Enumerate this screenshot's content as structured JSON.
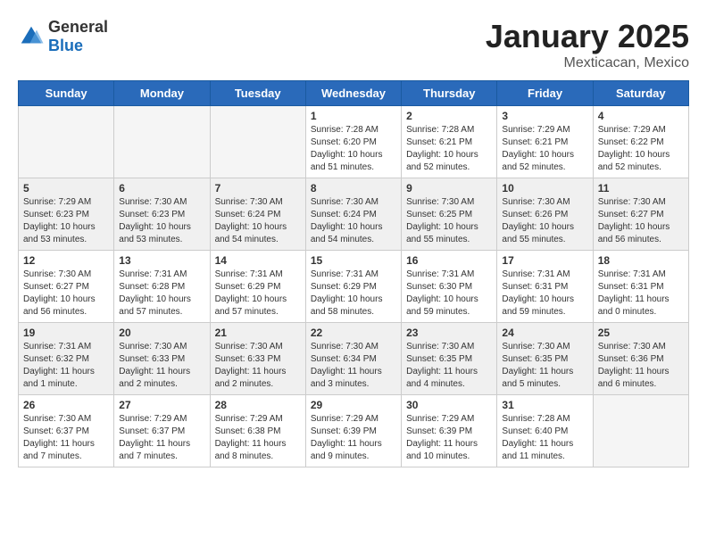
{
  "logo": {
    "text_general": "General",
    "text_blue": "Blue"
  },
  "header": {
    "month_year": "January 2025",
    "location": "Mexticacan, Mexico"
  },
  "weekdays": [
    "Sunday",
    "Monday",
    "Tuesday",
    "Wednesday",
    "Thursday",
    "Friday",
    "Saturday"
  ],
  "weeks": [
    {
      "shaded": false,
      "days": [
        {
          "num": "",
          "info": ""
        },
        {
          "num": "",
          "info": ""
        },
        {
          "num": "",
          "info": ""
        },
        {
          "num": "1",
          "info": "Sunrise: 7:28 AM\nSunset: 6:20 PM\nDaylight: 10 hours\nand 51 minutes."
        },
        {
          "num": "2",
          "info": "Sunrise: 7:28 AM\nSunset: 6:21 PM\nDaylight: 10 hours\nand 52 minutes."
        },
        {
          "num": "3",
          "info": "Sunrise: 7:29 AM\nSunset: 6:21 PM\nDaylight: 10 hours\nand 52 minutes."
        },
        {
          "num": "4",
          "info": "Sunrise: 7:29 AM\nSunset: 6:22 PM\nDaylight: 10 hours\nand 52 minutes."
        }
      ]
    },
    {
      "shaded": true,
      "days": [
        {
          "num": "5",
          "info": "Sunrise: 7:29 AM\nSunset: 6:23 PM\nDaylight: 10 hours\nand 53 minutes."
        },
        {
          "num": "6",
          "info": "Sunrise: 7:30 AM\nSunset: 6:23 PM\nDaylight: 10 hours\nand 53 minutes."
        },
        {
          "num": "7",
          "info": "Sunrise: 7:30 AM\nSunset: 6:24 PM\nDaylight: 10 hours\nand 54 minutes."
        },
        {
          "num": "8",
          "info": "Sunrise: 7:30 AM\nSunset: 6:24 PM\nDaylight: 10 hours\nand 54 minutes."
        },
        {
          "num": "9",
          "info": "Sunrise: 7:30 AM\nSunset: 6:25 PM\nDaylight: 10 hours\nand 55 minutes."
        },
        {
          "num": "10",
          "info": "Sunrise: 7:30 AM\nSunset: 6:26 PM\nDaylight: 10 hours\nand 55 minutes."
        },
        {
          "num": "11",
          "info": "Sunrise: 7:30 AM\nSunset: 6:27 PM\nDaylight: 10 hours\nand 56 minutes."
        }
      ]
    },
    {
      "shaded": false,
      "days": [
        {
          "num": "12",
          "info": "Sunrise: 7:30 AM\nSunset: 6:27 PM\nDaylight: 10 hours\nand 56 minutes."
        },
        {
          "num": "13",
          "info": "Sunrise: 7:31 AM\nSunset: 6:28 PM\nDaylight: 10 hours\nand 57 minutes."
        },
        {
          "num": "14",
          "info": "Sunrise: 7:31 AM\nSunset: 6:29 PM\nDaylight: 10 hours\nand 57 minutes."
        },
        {
          "num": "15",
          "info": "Sunrise: 7:31 AM\nSunset: 6:29 PM\nDaylight: 10 hours\nand 58 minutes."
        },
        {
          "num": "16",
          "info": "Sunrise: 7:31 AM\nSunset: 6:30 PM\nDaylight: 10 hours\nand 59 minutes."
        },
        {
          "num": "17",
          "info": "Sunrise: 7:31 AM\nSunset: 6:31 PM\nDaylight: 10 hours\nand 59 minutes."
        },
        {
          "num": "18",
          "info": "Sunrise: 7:31 AM\nSunset: 6:31 PM\nDaylight: 11 hours\nand 0 minutes."
        }
      ]
    },
    {
      "shaded": true,
      "days": [
        {
          "num": "19",
          "info": "Sunrise: 7:31 AM\nSunset: 6:32 PM\nDaylight: 11 hours\nand 1 minute."
        },
        {
          "num": "20",
          "info": "Sunrise: 7:30 AM\nSunset: 6:33 PM\nDaylight: 11 hours\nand 2 minutes."
        },
        {
          "num": "21",
          "info": "Sunrise: 7:30 AM\nSunset: 6:33 PM\nDaylight: 11 hours\nand 2 minutes."
        },
        {
          "num": "22",
          "info": "Sunrise: 7:30 AM\nSunset: 6:34 PM\nDaylight: 11 hours\nand 3 minutes."
        },
        {
          "num": "23",
          "info": "Sunrise: 7:30 AM\nSunset: 6:35 PM\nDaylight: 11 hours\nand 4 minutes."
        },
        {
          "num": "24",
          "info": "Sunrise: 7:30 AM\nSunset: 6:35 PM\nDaylight: 11 hours\nand 5 minutes."
        },
        {
          "num": "25",
          "info": "Sunrise: 7:30 AM\nSunset: 6:36 PM\nDaylight: 11 hours\nand 6 minutes."
        }
      ]
    },
    {
      "shaded": false,
      "days": [
        {
          "num": "26",
          "info": "Sunrise: 7:30 AM\nSunset: 6:37 PM\nDaylight: 11 hours\nand 7 minutes."
        },
        {
          "num": "27",
          "info": "Sunrise: 7:29 AM\nSunset: 6:37 PM\nDaylight: 11 hours\nand 7 minutes."
        },
        {
          "num": "28",
          "info": "Sunrise: 7:29 AM\nSunset: 6:38 PM\nDaylight: 11 hours\nand 8 minutes."
        },
        {
          "num": "29",
          "info": "Sunrise: 7:29 AM\nSunset: 6:39 PM\nDaylight: 11 hours\nand 9 minutes."
        },
        {
          "num": "30",
          "info": "Sunrise: 7:29 AM\nSunset: 6:39 PM\nDaylight: 11 hours\nand 10 minutes."
        },
        {
          "num": "31",
          "info": "Sunrise: 7:28 AM\nSunset: 6:40 PM\nDaylight: 11 hours\nand 11 minutes."
        },
        {
          "num": "",
          "info": ""
        }
      ]
    }
  ]
}
